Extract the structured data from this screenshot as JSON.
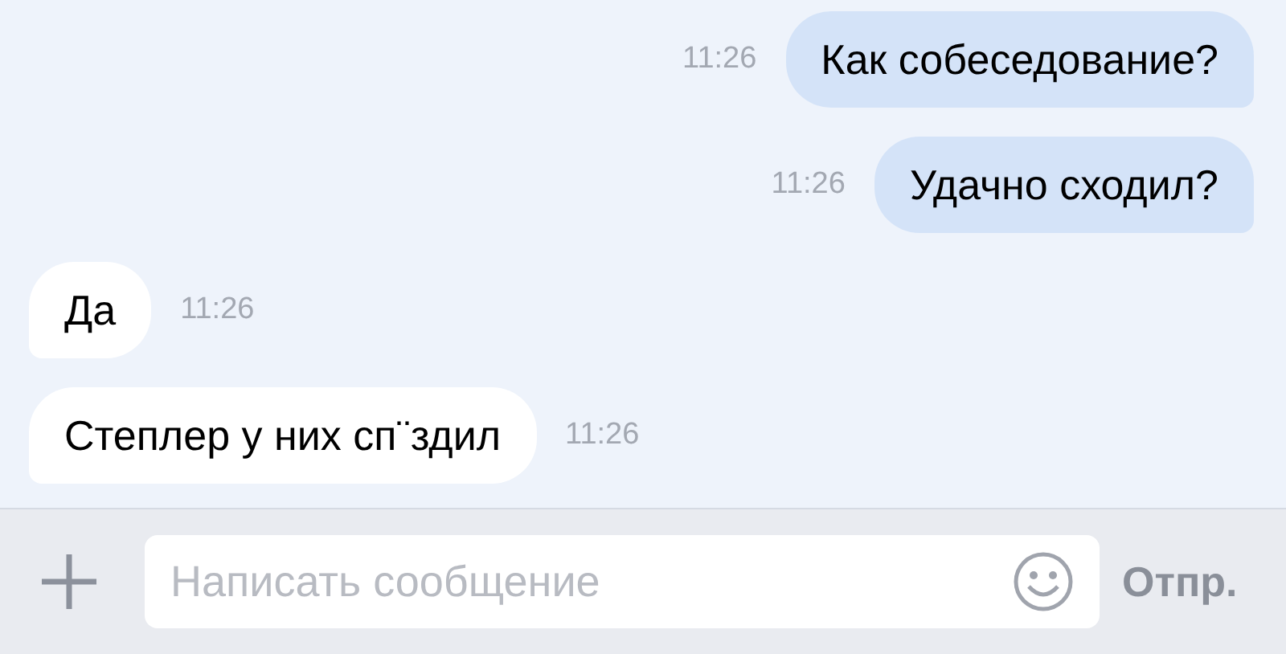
{
  "messages": [
    {
      "kind": "outgoing",
      "text": "Как собеседование?",
      "time": "11:26"
    },
    {
      "kind": "outgoing",
      "text": "Удачно сходил?",
      "time": "11:26"
    },
    {
      "kind": "incoming",
      "text": "Да",
      "time": "11:26"
    },
    {
      "kind": "incoming",
      "text": "Степлер у них сп¨здил",
      "time": "11:26"
    }
  ],
  "composer": {
    "placeholder": "Написать сообщение",
    "send_label": "Отпр."
  }
}
